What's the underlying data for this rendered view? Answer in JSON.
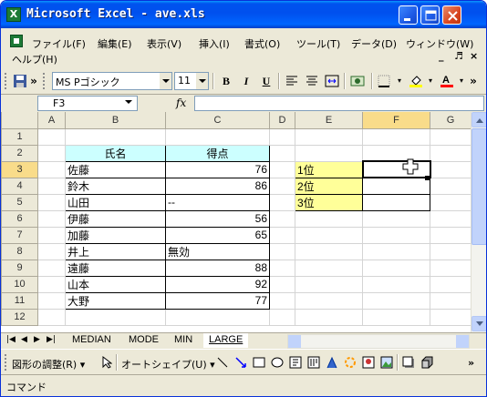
{
  "window": {
    "title": "Microsoft Excel - ave.xls",
    "app_icon_letter": "X"
  },
  "menu": {
    "items": [
      "ファイル(F)",
      "編集(E)",
      "表示(V)",
      "挿入(I)",
      "書式(O)",
      "ツール(T)",
      "データ(D)",
      "ウィンドウ(W)",
      "ヘルプ(H)"
    ],
    "mdi_controls": [
      "_",
      "♬",
      "×"
    ]
  },
  "toolbar": {
    "font_name": "MS Pゴシック",
    "font_size": "11",
    "bold": "B",
    "italic": "I",
    "underline": "U",
    "overflow": "»"
  },
  "formula_bar": {
    "name_box": "F3",
    "fx": "fx",
    "value": ""
  },
  "grid": {
    "columns": [
      "A",
      "B",
      "C",
      "D",
      "E",
      "F",
      "G"
    ],
    "rows": [
      "1",
      "2",
      "3",
      "4",
      "5",
      "6",
      "7",
      "8",
      "9",
      "10",
      "11",
      "12"
    ],
    "selected_cell": "F3",
    "table_header": {
      "name": "氏名",
      "score": "得点"
    },
    "records": [
      {
        "name": "佐藤",
        "score": "76"
      },
      {
        "name": "鈴木",
        "score": "86"
      },
      {
        "name": "山田",
        "score": "--"
      },
      {
        "name": "伊藤",
        "score": "56"
      },
      {
        "name": "加藤",
        "score": "65"
      },
      {
        "name": "井上",
        "score": "無効"
      },
      {
        "name": "遠藤",
        "score": "88"
      },
      {
        "name": "山本",
        "score": "92"
      },
      {
        "name": "大野",
        "score": "77"
      }
    ],
    "ranks": [
      "1位",
      "2位",
      "3位"
    ],
    "colors": {
      "header_fill": "#ccffff",
      "rank_fill": "#ffff99",
      "selected_header": "#f9dc8a"
    }
  },
  "sheet_tabs": {
    "tabs": [
      "MEDIAN",
      "MODE",
      "MIN",
      "LARGE"
    ],
    "active": "LARGE"
  },
  "drawing_bar": {
    "draw_menu": "図形の調整(R) ▾",
    "autoshape_menu": "オートシェイプ(U) ▾"
  },
  "status": {
    "text": "コマンド"
  }
}
